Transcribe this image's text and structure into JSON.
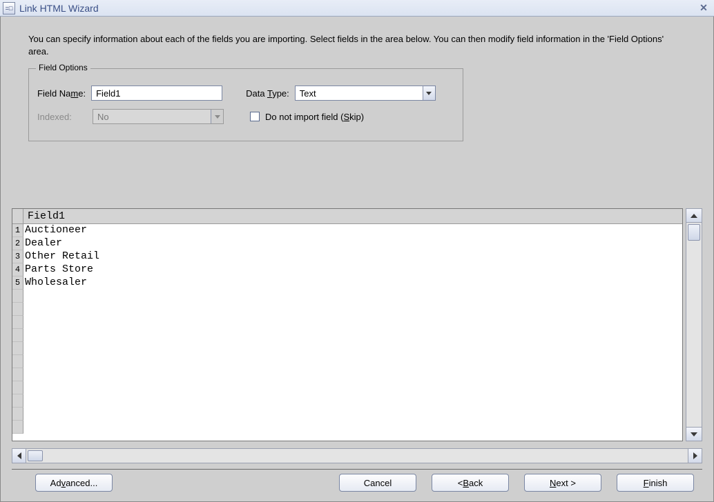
{
  "window": {
    "title": "Link HTML Wizard"
  },
  "intro": "You can specify information about each of the fields you are importing.  Select fields in the area below. You can then modify field information in the 'Field Options' area.",
  "fieldOptions": {
    "legend": "Field Options",
    "fieldName": {
      "label_pre": "Field Na",
      "label_ul": "m",
      "label_post": "e:",
      "value": "Field1"
    },
    "dataType": {
      "label_pre": "Data ",
      "label_ul": "T",
      "label_post": "ype:",
      "value": "Text"
    },
    "indexed": {
      "label": "Indexed:",
      "value": "No"
    },
    "skip": {
      "label_pre": "Do not import field (",
      "label_ul": "S",
      "label_post": "kip)",
      "checked": false
    }
  },
  "grid": {
    "column": "Field1",
    "rows": [
      "Auctioneer",
      "Dealer",
      "Other Retail",
      "Parts Store",
      "Wholesaler"
    ],
    "rownums": [
      "1",
      "2",
      "3",
      "4",
      "5"
    ]
  },
  "buttons": {
    "advanced": {
      "pre": "Ad",
      "ul": "v",
      "post": "anced..."
    },
    "cancel": {
      "text": "Cancel"
    },
    "back": {
      "pre": "< ",
      "ul": "B",
      "post": "ack"
    },
    "next": {
      "ul": "N",
      "post": "ext >"
    },
    "finish": {
      "ul": "F",
      "post": "inish"
    }
  }
}
